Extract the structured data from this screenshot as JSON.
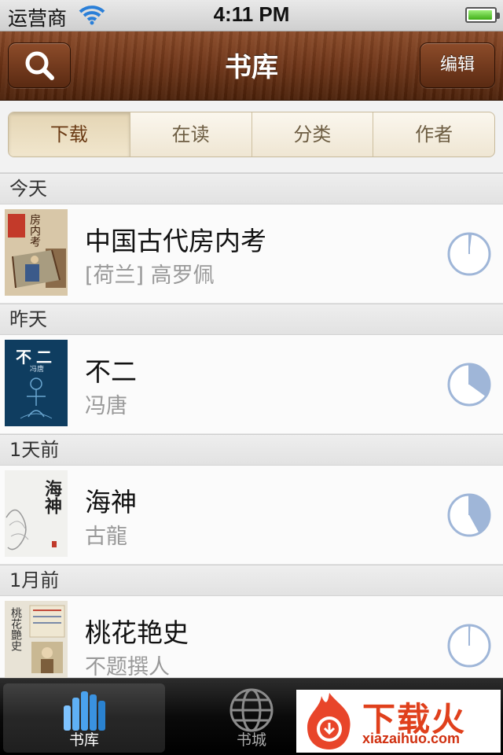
{
  "status_bar": {
    "carrier": "运营商",
    "time": "4:11 PM",
    "battery_level": 0.95
  },
  "nav": {
    "title": "书库",
    "edit_label": "编辑",
    "search_icon": "search-icon"
  },
  "segments": [
    {
      "label": "下载",
      "active": true
    },
    {
      "label": "在读",
      "active": false
    },
    {
      "label": "分类",
      "active": false
    },
    {
      "label": "作者",
      "active": false
    }
  ],
  "sections": [
    {
      "header": "今天",
      "book": {
        "title": "中国古代房内考",
        "author": "[荷兰] 高罗佩",
        "progress": 0.02,
        "cover_text": "房内考"
      }
    },
    {
      "header": "昨天",
      "book": {
        "title": "不二",
        "author": "冯唐",
        "progress": 0.35,
        "cover_text": "不二",
        "cover_sub": "冯唐"
      }
    },
    {
      "header": "1天前",
      "book": {
        "title": "海神",
        "author": "古龍",
        "progress": 0.42,
        "cover_text": "海神"
      }
    },
    {
      "header": "1月前",
      "book": {
        "title": "桃花艳史",
        "author": "不题撰人",
        "progress": 0.01,
        "cover_text": "桃花艷史"
      }
    }
  ],
  "tabbar": [
    {
      "label": "书库",
      "icon": "bookshelf-icon",
      "active": true
    },
    {
      "label": "书城",
      "icon": "globe-icon",
      "active": false
    }
  ],
  "colors": {
    "accent": "#7a3d1c",
    "progress": "#9fb6d8",
    "watermark": "#e0401c"
  },
  "watermark": {
    "main": "下载火",
    "sub": "xiazaihuo.com"
  }
}
